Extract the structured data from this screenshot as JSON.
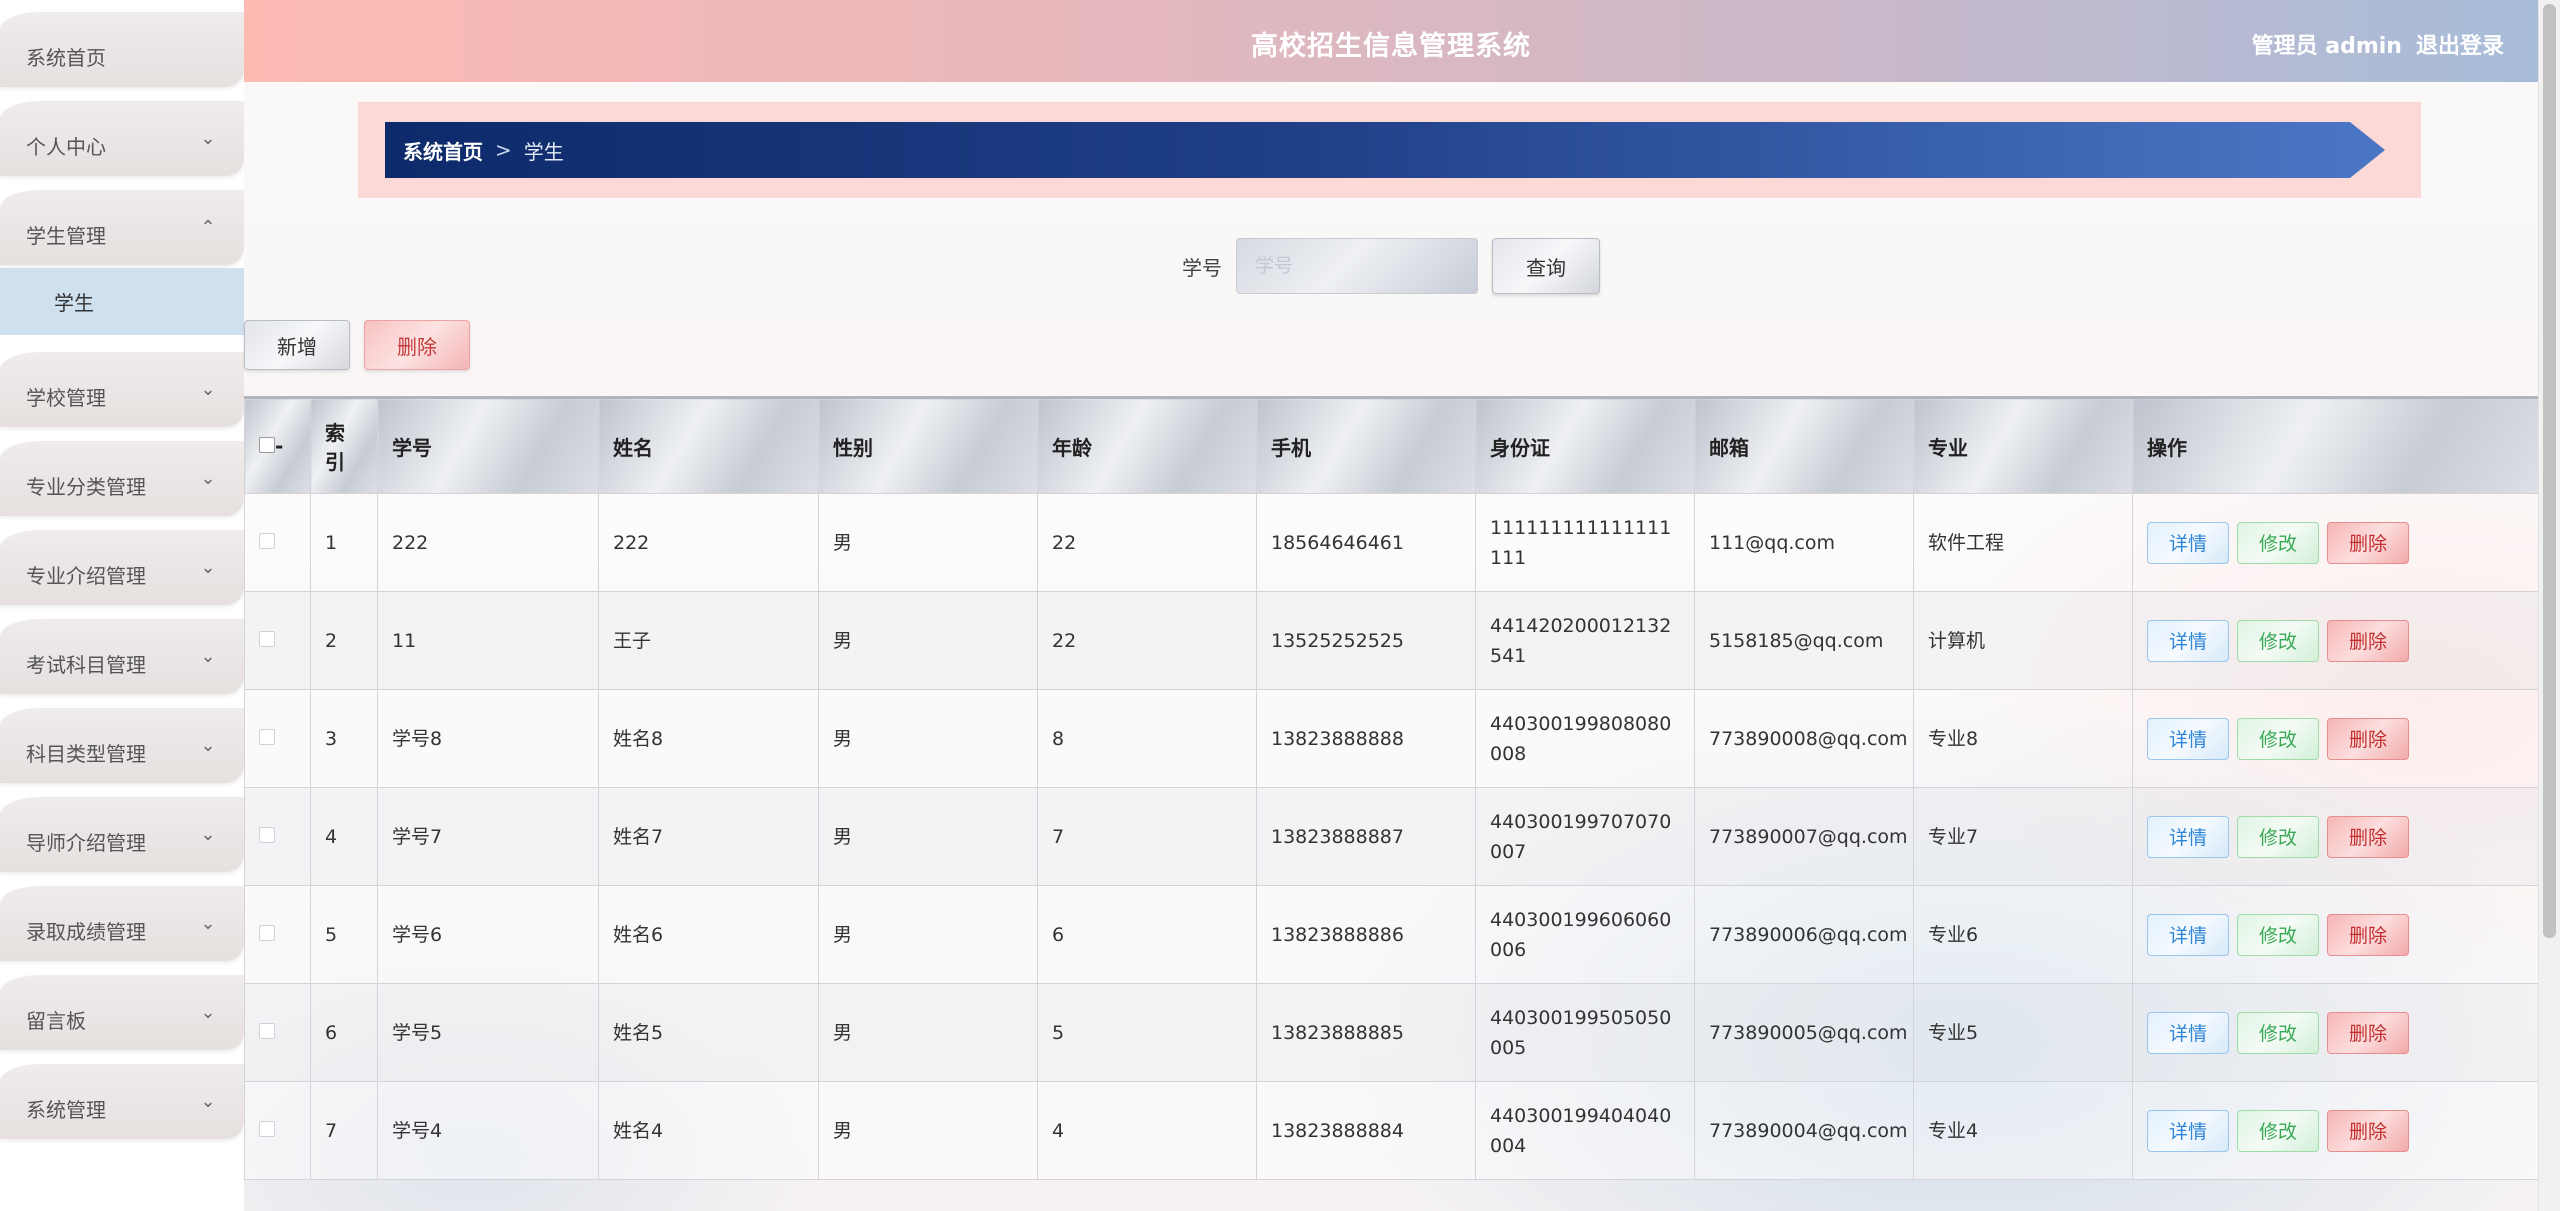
{
  "header": {
    "title": "高校招生信息管理系统",
    "user_label": "管理员 admin",
    "logout_label": "退出登录"
  },
  "sidebar": {
    "items": [
      {
        "label": "系统首页",
        "has_chevron": false
      },
      {
        "label": "个人中心",
        "has_chevron": true
      },
      {
        "label": "学生管理",
        "has_chevron": true,
        "expanded": true
      },
      {
        "label": "学校管理",
        "has_chevron": true
      },
      {
        "label": "专业分类管理",
        "has_chevron": true
      },
      {
        "label": "专业介绍管理",
        "has_chevron": true
      },
      {
        "label": "考试科目管理",
        "has_chevron": true
      },
      {
        "label": "科目类型管理",
        "has_chevron": true
      },
      {
        "label": "导师介绍管理",
        "has_chevron": true
      },
      {
        "label": "录取成绩管理",
        "has_chevron": true
      },
      {
        "label": "留言板",
        "has_chevron": true
      },
      {
        "label": "系统管理",
        "has_chevron": true
      }
    ],
    "sub_item": "学生"
  },
  "breadcrumb": {
    "home": "系统首页",
    "separator": ">",
    "current": "学生"
  },
  "search": {
    "label": "学号",
    "placeholder": "学号",
    "button": "查询"
  },
  "actions": {
    "add": "新增",
    "delete": "删除"
  },
  "table": {
    "columns": [
      "-",
      "索引",
      "学号",
      "姓名",
      "性别",
      "年龄",
      "手机",
      "身份证",
      "邮箱",
      "专业",
      "操作"
    ],
    "rows": [
      {
        "index": "1",
        "student_no": "222",
        "name": "222",
        "gender": "男",
        "age": "22",
        "phone": "18564646461",
        "id_card": "111111111111111111",
        "email": "111@qq.com",
        "major": "软件工程"
      },
      {
        "index": "2",
        "student_no": "11",
        "name": "王子",
        "gender": "男",
        "age": "22",
        "phone": "13525252525",
        "id_card": "441420200012132541",
        "email": "5158185@qq.com",
        "major": "计算机"
      },
      {
        "index": "3",
        "student_no": "学号8",
        "name": "姓名8",
        "gender": "男",
        "age": "8",
        "phone": "13823888888",
        "id_card": "440300199808080008",
        "email": "773890008@qq.com",
        "major": "专业8"
      },
      {
        "index": "4",
        "student_no": "学号7",
        "name": "姓名7",
        "gender": "男",
        "age": "7",
        "phone": "13823888887",
        "id_card": "440300199707070007",
        "email": "773890007@qq.com",
        "major": "专业7"
      },
      {
        "index": "5",
        "student_no": "学号6",
        "name": "姓名6",
        "gender": "男",
        "age": "6",
        "phone": "13823888886",
        "id_card": "440300199606060006",
        "email": "773890006@qq.com",
        "major": "专业6"
      },
      {
        "index": "6",
        "student_no": "学号5",
        "name": "姓名5",
        "gender": "男",
        "age": "5",
        "phone": "13823888885",
        "id_card": "440300199505050005",
        "email": "773890005@qq.com",
        "major": "专业5"
      },
      {
        "index": "7",
        "student_no": "学号4",
        "name": "姓名4",
        "gender": "男",
        "age": "4",
        "phone": "13823888884",
        "id_card": "440300199404040004",
        "email": "773890004@qq.com",
        "major": "专业4"
      }
    ],
    "row_actions": {
      "detail": "详情",
      "edit": "修改",
      "delete": "删除"
    }
  },
  "colors": {
    "header_start": "#fcbab3",
    "header_end": "#a7bcd9",
    "crumb_dark": "#0d2a6b",
    "crumb_light": "#4b77c6",
    "detail_blue": "#2f86d6",
    "edit_green": "#3aa957",
    "delete_red": "#c22f2f"
  }
}
